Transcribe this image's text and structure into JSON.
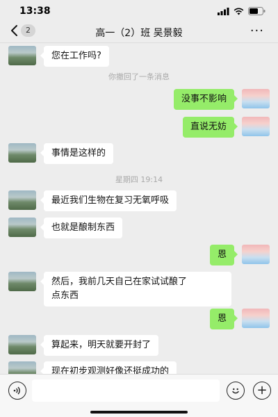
{
  "status_bar": {
    "time": "13:38"
  },
  "nav": {
    "back_badge": "2",
    "title": "高一（2）班 吴景毅",
    "more": "···"
  },
  "messages": [
    {
      "side": "left",
      "text": "您在工作吗?"
    },
    {
      "type": "system",
      "text": "你撤回了一条消息"
    },
    {
      "side": "right",
      "text": "没事不影响"
    },
    {
      "side": "right",
      "text": "直说无妨"
    },
    {
      "side": "left",
      "text": "事情是这样的"
    },
    {
      "type": "system",
      "text": "星期四 19:14"
    },
    {
      "side": "left",
      "text": "最近我们生物在复习无氧呼吸"
    },
    {
      "side": "left",
      "text": "也就是酿制东西"
    },
    {
      "side": "right",
      "text": "恩"
    },
    {
      "side": "left",
      "text": "然后，我前几天自己在家试试酿了\n点东西"
    },
    {
      "side": "right",
      "text": "恩"
    },
    {
      "side": "left",
      "text": "算起来，明天就要开封了"
    },
    {
      "side": "left",
      "text": "现在初步观测好像还挺成功的"
    }
  ],
  "input_bar": {
    "voice_icon": "voice-icon",
    "emoji_icon": "emoji-icon",
    "plus_icon": "plus-icon",
    "plus_glyph": "+"
  },
  "colors": {
    "background": "#ededed",
    "bubble_self": "#95ec69",
    "bubble_other": "#ffffff",
    "system_text": "#a9a9a9"
  }
}
